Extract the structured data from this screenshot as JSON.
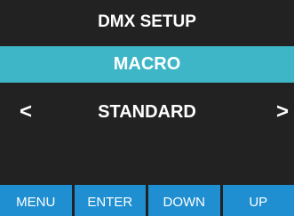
{
  "header": {
    "title": "DMX SETUP"
  },
  "menu": {
    "selected_item": "MACRO"
  },
  "value_selector": {
    "prev_symbol": "<",
    "value": "STANDARD",
    "next_symbol": ">"
  },
  "softkeys": [
    {
      "label": "MENU"
    },
    {
      "label": "ENTER"
    },
    {
      "label": "DOWN"
    },
    {
      "label": "UP"
    }
  ],
  "colors": {
    "background": "#222222",
    "highlight": "#3eb6c7",
    "softkey": "#1f8fd1",
    "text": "#ffffff"
  }
}
